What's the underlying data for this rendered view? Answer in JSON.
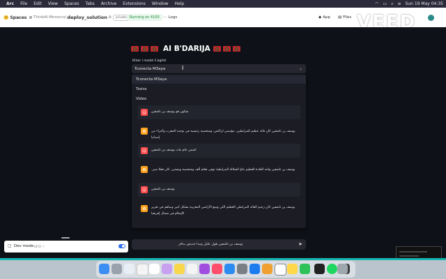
{
  "menubar": {
    "app": "Arc",
    "items": [
      "File",
      "Edit",
      "View",
      "Spaces",
      "Tabs",
      "Archive",
      "Extensions",
      "Window",
      "Help"
    ],
    "clock": "Sun 19 May  04:35"
  },
  "toolbar": {
    "spaces_label": "Spaces",
    "owner": "ThinkAI-Morocco",
    "repo": "deploy_solution",
    "private_label": "private",
    "status": "Running on 4100",
    "logs_label": "Logs",
    "app_tab": "App",
    "files_tab": "Files",
    "watermark": "VEED"
  },
  "app": {
    "title_text": "AI B'DARIJA",
    "select_label": "Khtar l model li bghiti",
    "select_value": "Tconecta M3aya",
    "dropdown_options": [
      {
        "label": "Tconecta M3aya"
      },
      {
        "label": "Tssira"
      },
      {
        "label": "Video"
      }
    ],
    "messages": [
      {
        "role": "user",
        "avatar": "red",
        "text": "شكون هو يوسف بن تاشفين"
      },
      {
        "role": "assistant",
        "avatar": "orange",
        "text": "يوسف بن تاشفين كان قائد عظيم للمرابطين، مؤسس لراكش، وشخصية رئيسية في توحيد المغرب وأجزاء من إسبانيا"
      },
      {
        "role": "user",
        "avatar": "red",
        "text": "اشمن عام مات يوسف بن تاشفين"
      },
      {
        "role": "assistant",
        "avatar": "orange",
        "text": "يوسف بن تاشفين واحد القادة العظيم نتاع السلالة المرابطية توفى فعام ألف وشخصية وبستين. كان قعلا مبير."
      },
      {
        "role": "user",
        "avatar": "red",
        "text": "يوسف بن تاشفين"
      },
      {
        "role": "assistant",
        "avatar": "orange",
        "text": "يوسف بن تاشفين كان زعيم القائد المرابطي العظيم اللي وسع الأراضي المغربية بشكل كبير وساهم في تعزيز الإسلام في شمال إفريقيا"
      }
    ],
    "chat_input_value": "يوسف بن تاشفين هول عليل ومدا جديش بدافر",
    "dev_mode_label": "Dev mode",
    "dev_mode_badge": "BETA ⓘ",
    "dev_mode_on": true
  },
  "colors": {
    "app_bg": "#0e1117",
    "user_avatar": "#ff4b4b",
    "assistant_avatar": "#ffa421",
    "accent_teal": "#15b5b0",
    "running_green": "#1e8a3b"
  }
}
